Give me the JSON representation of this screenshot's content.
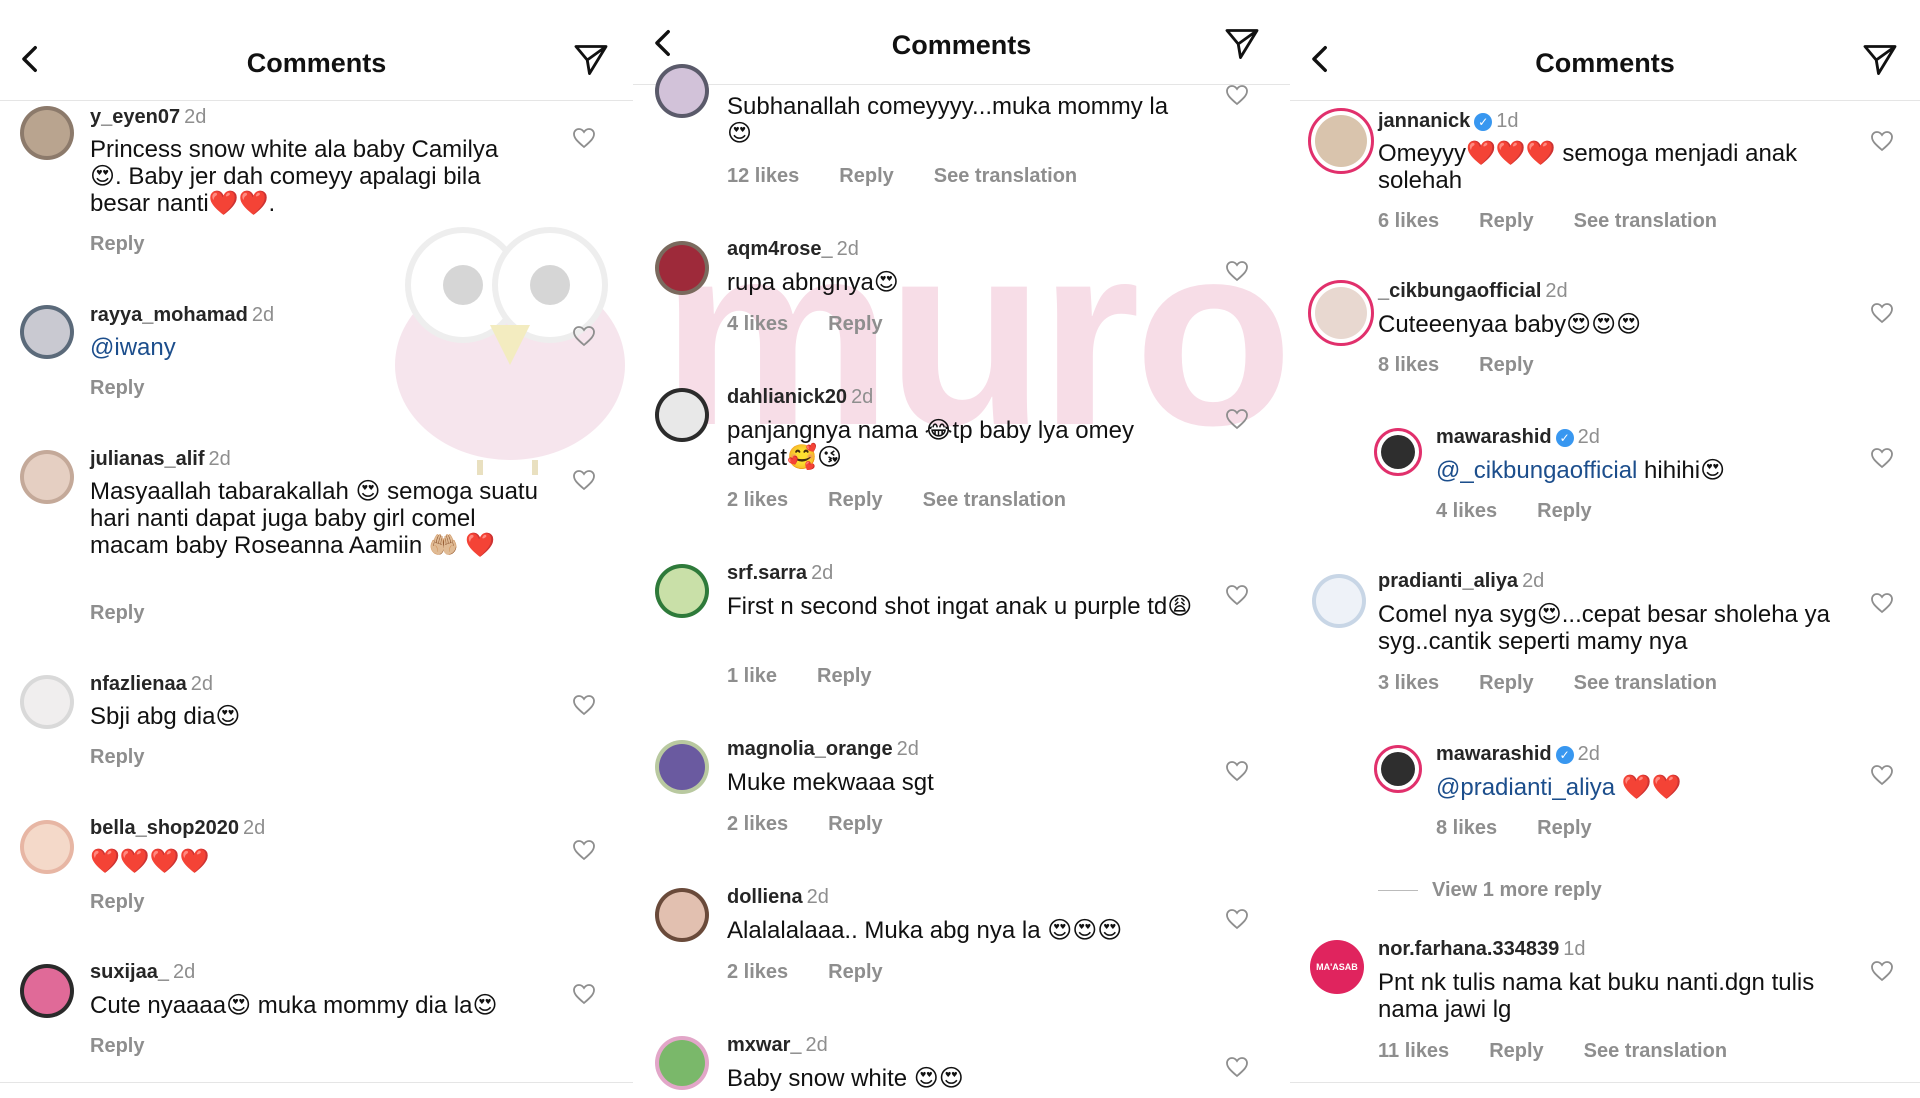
{
  "header": {
    "title": "Comments"
  },
  "panel1": {
    "comments": [
      {
        "user": "y_eyen07",
        "time": "2d",
        "text": "Princess snow white ala baby Camilya 😍. Baby jer dah comeyy apalagi bila besar nanti❤️❤️.",
        "reply": "Reply"
      },
      {
        "user": "rayya_mohamad",
        "time": "2d",
        "text": "@iwany",
        "reply": "Reply"
      },
      {
        "user": "julianas_alif",
        "time": "2d",
        "text": "Masyaallah tabarakallah 😍 semoga suatu hari nanti dapat juga baby girl comel macam baby Roseanna Aamiin 🤲🏼 ❤️",
        "reply": "Reply"
      },
      {
        "user": "nfazlienaa",
        "time": "2d",
        "text": "Sbji abg dia😍",
        "reply": "Reply"
      },
      {
        "user": "bella_shop2020",
        "time": "2d",
        "text": "❤️❤️❤️❤️",
        "reply": "Reply"
      },
      {
        "user": "suxijaa_",
        "time": "2d",
        "text": "Cute nyaaaa😍 muka mommy dia la😍",
        "reply": "Reply"
      }
    ]
  },
  "panel2": {
    "comments": [
      {
        "user": "",
        "time": "",
        "text": "Subhanallah comeyyyy...muka mommy la 😍",
        "likes": "12 likes",
        "reply": "Reply",
        "translate": "See translation"
      },
      {
        "user": "aqm4rose_",
        "time": "2d",
        "text": "rupa abngnya😍",
        "likes": "4 likes",
        "reply": "Reply",
        "translate": ""
      },
      {
        "user": "dahlianick20",
        "time": "2d",
        "text": "panjangnya nama 😂tp baby lya omey angat🥰😘",
        "likes": "2 likes",
        "reply": "Reply",
        "translate": "See translation"
      },
      {
        "user": "srf.sarra",
        "time": "2d",
        "text": "First n second shot ingat anak u purple td😩",
        "likes": "1 like",
        "reply": "Reply",
        "translate": ""
      },
      {
        "user": "magnolia_orange",
        "time": "2d",
        "text": "Muke mekwaaa sgt",
        "likes": "2 likes",
        "reply": "Reply",
        "translate": ""
      },
      {
        "user": "dolliena",
        "time": "2d",
        "text": "Alalalalaaa.. Muka abg nya la 😍😍😍",
        "likes": "2 likes",
        "reply": "Reply",
        "translate": ""
      },
      {
        "user": "mxwar_",
        "time": "2d",
        "text": "Baby snow white 😍😍",
        "likes": "",
        "reply": "",
        "translate": ""
      }
    ]
  },
  "panel3": {
    "comments": [
      {
        "user": "jannanick",
        "time": "1d",
        "text": "Omeyyy❤️❤️❤️ semoga menjadi anak solehah",
        "likes": "6 likes",
        "reply": "Reply",
        "translate": "See translation"
      },
      {
        "user": "_cikbungaofficial",
        "time": "2d",
        "text": "Cuteeenyaa baby😍😍😍",
        "likes": "8 likes",
        "reply": "Reply",
        "translate": ""
      },
      {
        "user": "mawarashid",
        "time": "2d",
        "text_mention": "@_cikbungaofficial",
        "text": " hihihi😍",
        "likes": "4 likes",
        "reply": "Reply",
        "translate": ""
      },
      {
        "user": "pradianti_aliya",
        "time": "2d",
        "text": "Comel nya syg😍...cepat besar sholeha ya syg..cantik seperti mamy nya",
        "likes": "3 likes",
        "reply": "Reply",
        "translate": "See translation"
      },
      {
        "user": "mawarashid",
        "time": "2d",
        "text_mention": "@pradianti_aliya",
        "text": " ❤️❤️",
        "likes": "8 likes",
        "reply": "Reply",
        "translate": ""
      },
      {
        "user": "nor.farhana.334839",
        "time": "1d",
        "text": "Pnt nk tulis nama kat buku nanti.dgn tulis nama jawi lg",
        "likes": "11 likes",
        "reply": "Reply",
        "translate": "See translation"
      }
    ],
    "view_more": "View 1 more reply"
  },
  "watermark": {
    "text": "muroi"
  },
  "avatar_logo_text": "MA'ASAB"
}
